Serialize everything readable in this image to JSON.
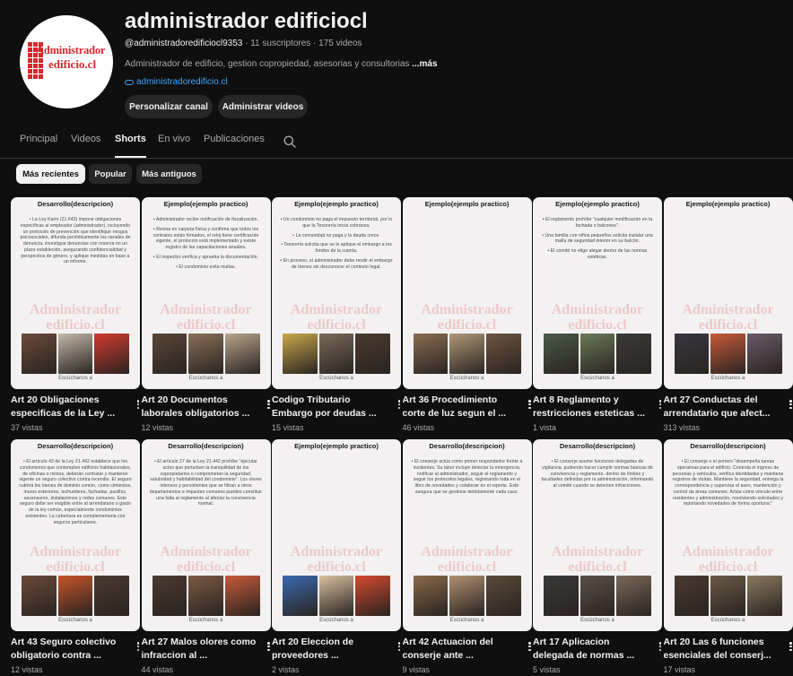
{
  "channel": {
    "title": "administrador edificiocl",
    "handle": "@administradoredificiocl9353",
    "stats": "· 11 suscriptores · 175 videos",
    "description": "Administrador de edificio, gestion copropiedad, asesorias y consultorias ",
    "more": "...más",
    "link": "administradoredificio.cl",
    "logo_line1": "Administrador",
    "logo_line2": "edificio.cl",
    "brand_color": "#d8262d"
  },
  "buttons": {
    "customize": "Personalizar canal",
    "manage": "Administrar videos"
  },
  "tabs": [
    {
      "label": "Principal"
    },
    {
      "label": "Videos"
    },
    {
      "label": "Shorts",
      "active": true
    },
    {
      "label": "En vivo"
    },
    {
      "label": "Publicaciones"
    }
  ],
  "chips": [
    {
      "label": "Más recientes",
      "active": true
    },
    {
      "label": "Popular"
    },
    {
      "label": "Más antiguos"
    }
  ],
  "shorts": [
    {
      "title": "Art 20 Obligaciones especificas de la Ley ...",
      "views": "37 vistas",
      "thumb_title": "Desarrollo(descripcion)",
      "thumb_footer": "Escúchanos a",
      "thumb_body": [
        "• La Ley Karin (21.643) impone obligaciones específicas al empleador (administrador), incluyendo un protocolo de prevención que identifique riesgos psicosociales, difunda periódicamente los canales de denuncia, investigue denuncias con reserva en un plazo establecido, asegurando confidencialidad y perspectiva de género, y aplique medidas en base a un informe."
      ],
      "photos": [
        "#6b4a3a",
        "#c4b9a8",
        "#d23a2f"
      ]
    },
    {
      "title": "Art 20 Documentos laborales obligatorios ...",
      "views": "12 vistas",
      "thumb_title": "Ejemplo(ejemplo practico)",
      "thumb_footer": "Escúchanos a",
      "thumb_body": [
        "• Administrador recibe notificación de fiscalización.",
        "• Revisa en carpeta física y confirma que todos los contratos están firmados, el reloj tiene certificación vigente, el protocolo está implementado y existe registro de las capacitaciones anuales.",
        "• El inspector verifica y aprueba la documentación.",
        "• El condominio evita multas."
      ],
      "photos": [
        "#5a4638",
        "#8a7058",
        "#b8a48c"
      ]
    },
    {
      "title": "Codigo Tributario Embargo por deudas ...",
      "views": "15 vistas",
      "thumb_title": "Ejemplo(ejemplo practico)",
      "thumb_footer": "Escúchanos a",
      "thumb_body": [
        "• Un condominio no paga el impuesto territorial, por lo que la Tesorería inicia cobranza.",
        "• La comunidad no paga y la deuda crece.",
        "• Tesorería solicita que se le aplique el embargo a los fondos de la cuenta.",
        "• En proceso, el administrador debe rendir el embargo de bienes sin desconocer el contexto legal."
      ],
      "photos": [
        "#c9a84c",
        "#7a6a5a",
        "#4a3a2e"
      ]
    },
    {
      "title": "Art 36 Procedimiento corte de luz segun el ...",
      "views": "46 vistas",
      "thumb_title": "Ejemplo(ejemplo practico)",
      "thumb_footer": "Escúchanos a",
      "thumb_body": [],
      "photos": [
        "#8a6e52",
        "#b09878",
        "#6e5440"
      ]
    },
    {
      "title": "Art 8 Reglamento y restricciones esteticas ...",
      "views": "1 vista",
      "thumb_title": "Ejemplo(ejemplo practico)",
      "thumb_footer": "Escúchanos a",
      "thumb_body": [
        "• El reglamento prohíbe \"cualquier modificación en la fachada o balcones\".",
        "• Una familia con niños pequeños solicita instalar una malla de seguridad interior en su balcón.",
        "• El comité no elige alegar dentro de las normas estéticas."
      ],
      "photos": [
        "#4a5a48",
        "#6a7a58",
        "#3a3a38"
      ]
    },
    {
      "title": "Art 27 Conductas del arrendatario que afect...",
      "views": "313 vistas",
      "thumb_title": "Ejemplo(ejemplo practico)",
      "thumb_footer": "Escúchanos a",
      "thumb_body": [],
      "photos": [
        "#3a3640",
        "#c85a3a",
        "#6a5a68"
      ]
    },
    {
      "title": "Art 43 Seguro colectivo obligatorio contra ...",
      "views": "12 vistas",
      "thumb_title": "Desarrollo(descripcion)",
      "thumb_footer": "Escúchanos a",
      "thumb_body": [
        "• El artículo 43 de la Ley 21.442 establece que los condominios que contemplen edificios habitacionales, de oficinas o mixtos, deberán contratar y mantener vigente un seguro colectivo contra incendio. El seguro cubrirá los bienes de dominio común, como cimientos, muros exteriores, techumbres, fachadas, pasillos, ascensores, instalaciones y redes comunes. Este seguro debe ser exigible entre al arrendatario o gasto de la ley común, especialmente condominios existentes. La cobertura es complementaria con seguros particulares."
      ],
      "photos": [
        "#6a4a3a",
        "#c8542a",
        "#4a3a30"
      ]
    },
    {
      "title": "Art 27 Malos olores como infraccion al ...",
      "views": "44 vistas",
      "thumb_title": "Desarrollo(descripcion)",
      "thumb_footer": "Escúchanos a",
      "thumb_body": [
        "• El artículo 27 de la Ley 21.442 prohíbe \"ejecutar actos que perturben la tranquilidad de los copropietarios o comprometan la seguridad, salubridad y habitabilidad del condominio\". Los olores intensos y persistentes que se filtran a otros departamentos e impacten comunes pueden constituir una falta al reglamento al afectar la convivencia normal."
      ],
      "photos": [
        "#4a3a30",
        "#7a5a44",
        "#c85a3a"
      ]
    },
    {
      "title": "Art 20 Eleccion de proveedores ...",
      "views": "2 vistas",
      "thumb_title": "Ejemplo(ejemplo practico)",
      "thumb_footer": "Escúchanos a",
      "thumb_body": [],
      "photos": [
        "#3a6ab0",
        "#d8c0a0",
        "#d24a30"
      ]
    },
    {
      "title": "Art 42 Actuacion del conserje ante ...",
      "views": "9 vistas",
      "thumb_title": "Desarrollo(descripcion)",
      "thumb_footer": "Escúchanos a",
      "thumb_body": [
        "• El conserje actúa como primer respondedor frente a incidentes. Su labor incluye detectar la emergencia, notificar al administrador, seguir el reglamento y seguir los protocolos legales, registrando toda en el libro de novedades y colaborar en el reporte. Esto asegura que se gestione debidamente cada caso."
      ],
      "photos": [
        "#8a6a4a",
        "#b09070",
        "#5a4a3a"
      ]
    },
    {
      "title": "Art 17 Aplicacion delegada de normas ...",
      "views": "5 vistas",
      "thumb_title": "Desarrollo(descripcion)",
      "thumb_footer": "Escúchanos a",
      "thumb_body": [
        "• El conserje asume funciones delegadas de vigilancia, pudiendo hacer cumplir normas básicas de convivencia y reglamento, dentro de límites y facultades definidas por la administración, informando al comité cuando se detecten infracciones."
      ],
      "photos": [
        "#3a3a3a",
        "#5a5048",
        "#7a6858"
      ]
    },
    {
      "title": "Art 20 Las 6 funciones esenciales del conserj...",
      "views": "17 vistas",
      "thumb_title": "Desarrollo(descripcion)",
      "thumb_footer": "Escúchanos a",
      "thumb_body": [
        "• El conserje o el portero \"desempeña tareas operativas para el edificio. Controla el ingreso de personas y vehículos, verifica identidades y mantiene registros de visitas. Mantiene la seguridad, entrega la correspondencia y supervisa el aseo, mantención y control de áreas comunes. Actúa como vínculo entre residentes y administración, resolviendo solicitudes y reportando novedades de forma oportuna.\""
      ],
      "photos": [
        "#4a3a30",
        "#6a5a48",
        "#8a7a60"
      ]
    }
  ]
}
